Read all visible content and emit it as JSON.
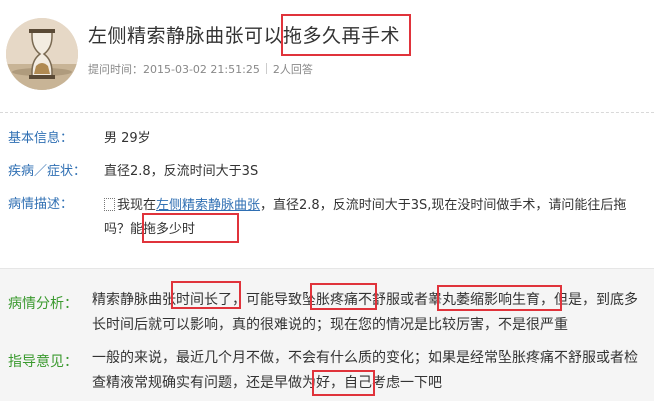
{
  "question": {
    "title": "左侧精索静脉曲张可以拖多久再手术",
    "meta_prefix": "提问时间：",
    "meta_time": "2015-03-02 21:51:25",
    "meta_answers": "2人回答"
  },
  "info": {
    "basic": {
      "label": "基本信息：",
      "value": "男 29岁"
    },
    "disease": {
      "label": "疾病／症状：",
      "value": "直径2.8，反流时间大于3S"
    },
    "desc": {
      "label": "病情描述：",
      "link": "左侧精索静脉曲张",
      "pre": "我现在",
      "post": "，直径2.8，反流时间大于3S,现在没时间做手术，请问能往后拖吗？能拖多少时"
    }
  },
  "answer": {
    "analysis": {
      "label": "病情分析：",
      "text": "精索静脉曲张时间长了，可能导致坠胀疼痛不舒服或者睾丸萎缩影响生育，但是，到底多长时间后就可以影响，真的很难说的；现在您的情况是比较厉害，不是很严重"
    },
    "advice": {
      "label": "指导意见：",
      "text": "一般的来说，最近几个月不做，不会有什么质的变化；如果是经常坠胀疼痛不舒服或者检查精液常规确实有问题，还是早做为好，自己考虑一下吧"
    }
  },
  "colors": {
    "label_blue": "#2f6fb3",
    "label_green": "#3b9a2f",
    "highlight_red": "#e0333b",
    "answer_bg": "#f5f5f5"
  }
}
